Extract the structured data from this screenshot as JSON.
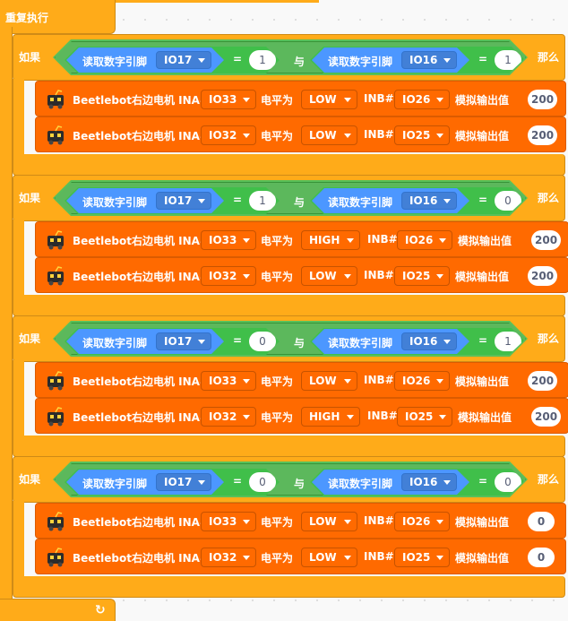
{
  "repeat": {
    "label": "重复执行",
    "loop_icon": "loop-arrow-icon"
  },
  "labels": {
    "if": "如果",
    "then": "那么",
    "and": "与",
    "equals": "=",
    "read_digital": "读取数字引脚",
    "motor_prefix": "Beetlebot右边电机 INA#",
    "level_is": "电平为",
    "inb": "INB#",
    "analog_out": "模拟输出值"
  },
  "colors": {
    "control": "#ffab19",
    "operator": "#59c059",
    "sensing": "#4c97ff",
    "motor": "#ff6a00"
  },
  "if_blocks": [
    {
      "cond1": {
        "pin": "IO17",
        "value": "1"
      },
      "cond2": {
        "pin": "IO16",
        "value": "1"
      },
      "motors": [
        {
          "ina": "IO33",
          "level": "LOW",
          "inb": "IO26",
          "output": "200"
        },
        {
          "ina": "IO32",
          "level": "LOW",
          "inb": "IO25",
          "output": "200"
        }
      ]
    },
    {
      "cond1": {
        "pin": "IO17",
        "value": "1"
      },
      "cond2": {
        "pin": "IO16",
        "value": "0"
      },
      "motors": [
        {
          "ina": "IO33",
          "level": "HIGH",
          "inb": "IO26",
          "output": "200"
        },
        {
          "ina": "IO32",
          "level": "LOW",
          "inb": "IO25",
          "output": "200"
        }
      ]
    },
    {
      "cond1": {
        "pin": "IO17",
        "value": "0"
      },
      "cond2": {
        "pin": "IO16",
        "value": "1"
      },
      "motors": [
        {
          "ina": "IO33",
          "level": "LOW",
          "inb": "IO26",
          "output": "200"
        },
        {
          "ina": "IO32",
          "level": "HIGH",
          "inb": "IO25",
          "output": "200"
        }
      ]
    },
    {
      "cond1": {
        "pin": "IO17",
        "value": "0"
      },
      "cond2": {
        "pin": "IO16",
        "value": "0"
      },
      "motors": [
        {
          "ina": "IO33",
          "level": "LOW",
          "inb": "IO26",
          "output": "0"
        },
        {
          "ina": "IO32",
          "level": "LOW",
          "inb": "IO25",
          "output": "0"
        }
      ]
    }
  ]
}
